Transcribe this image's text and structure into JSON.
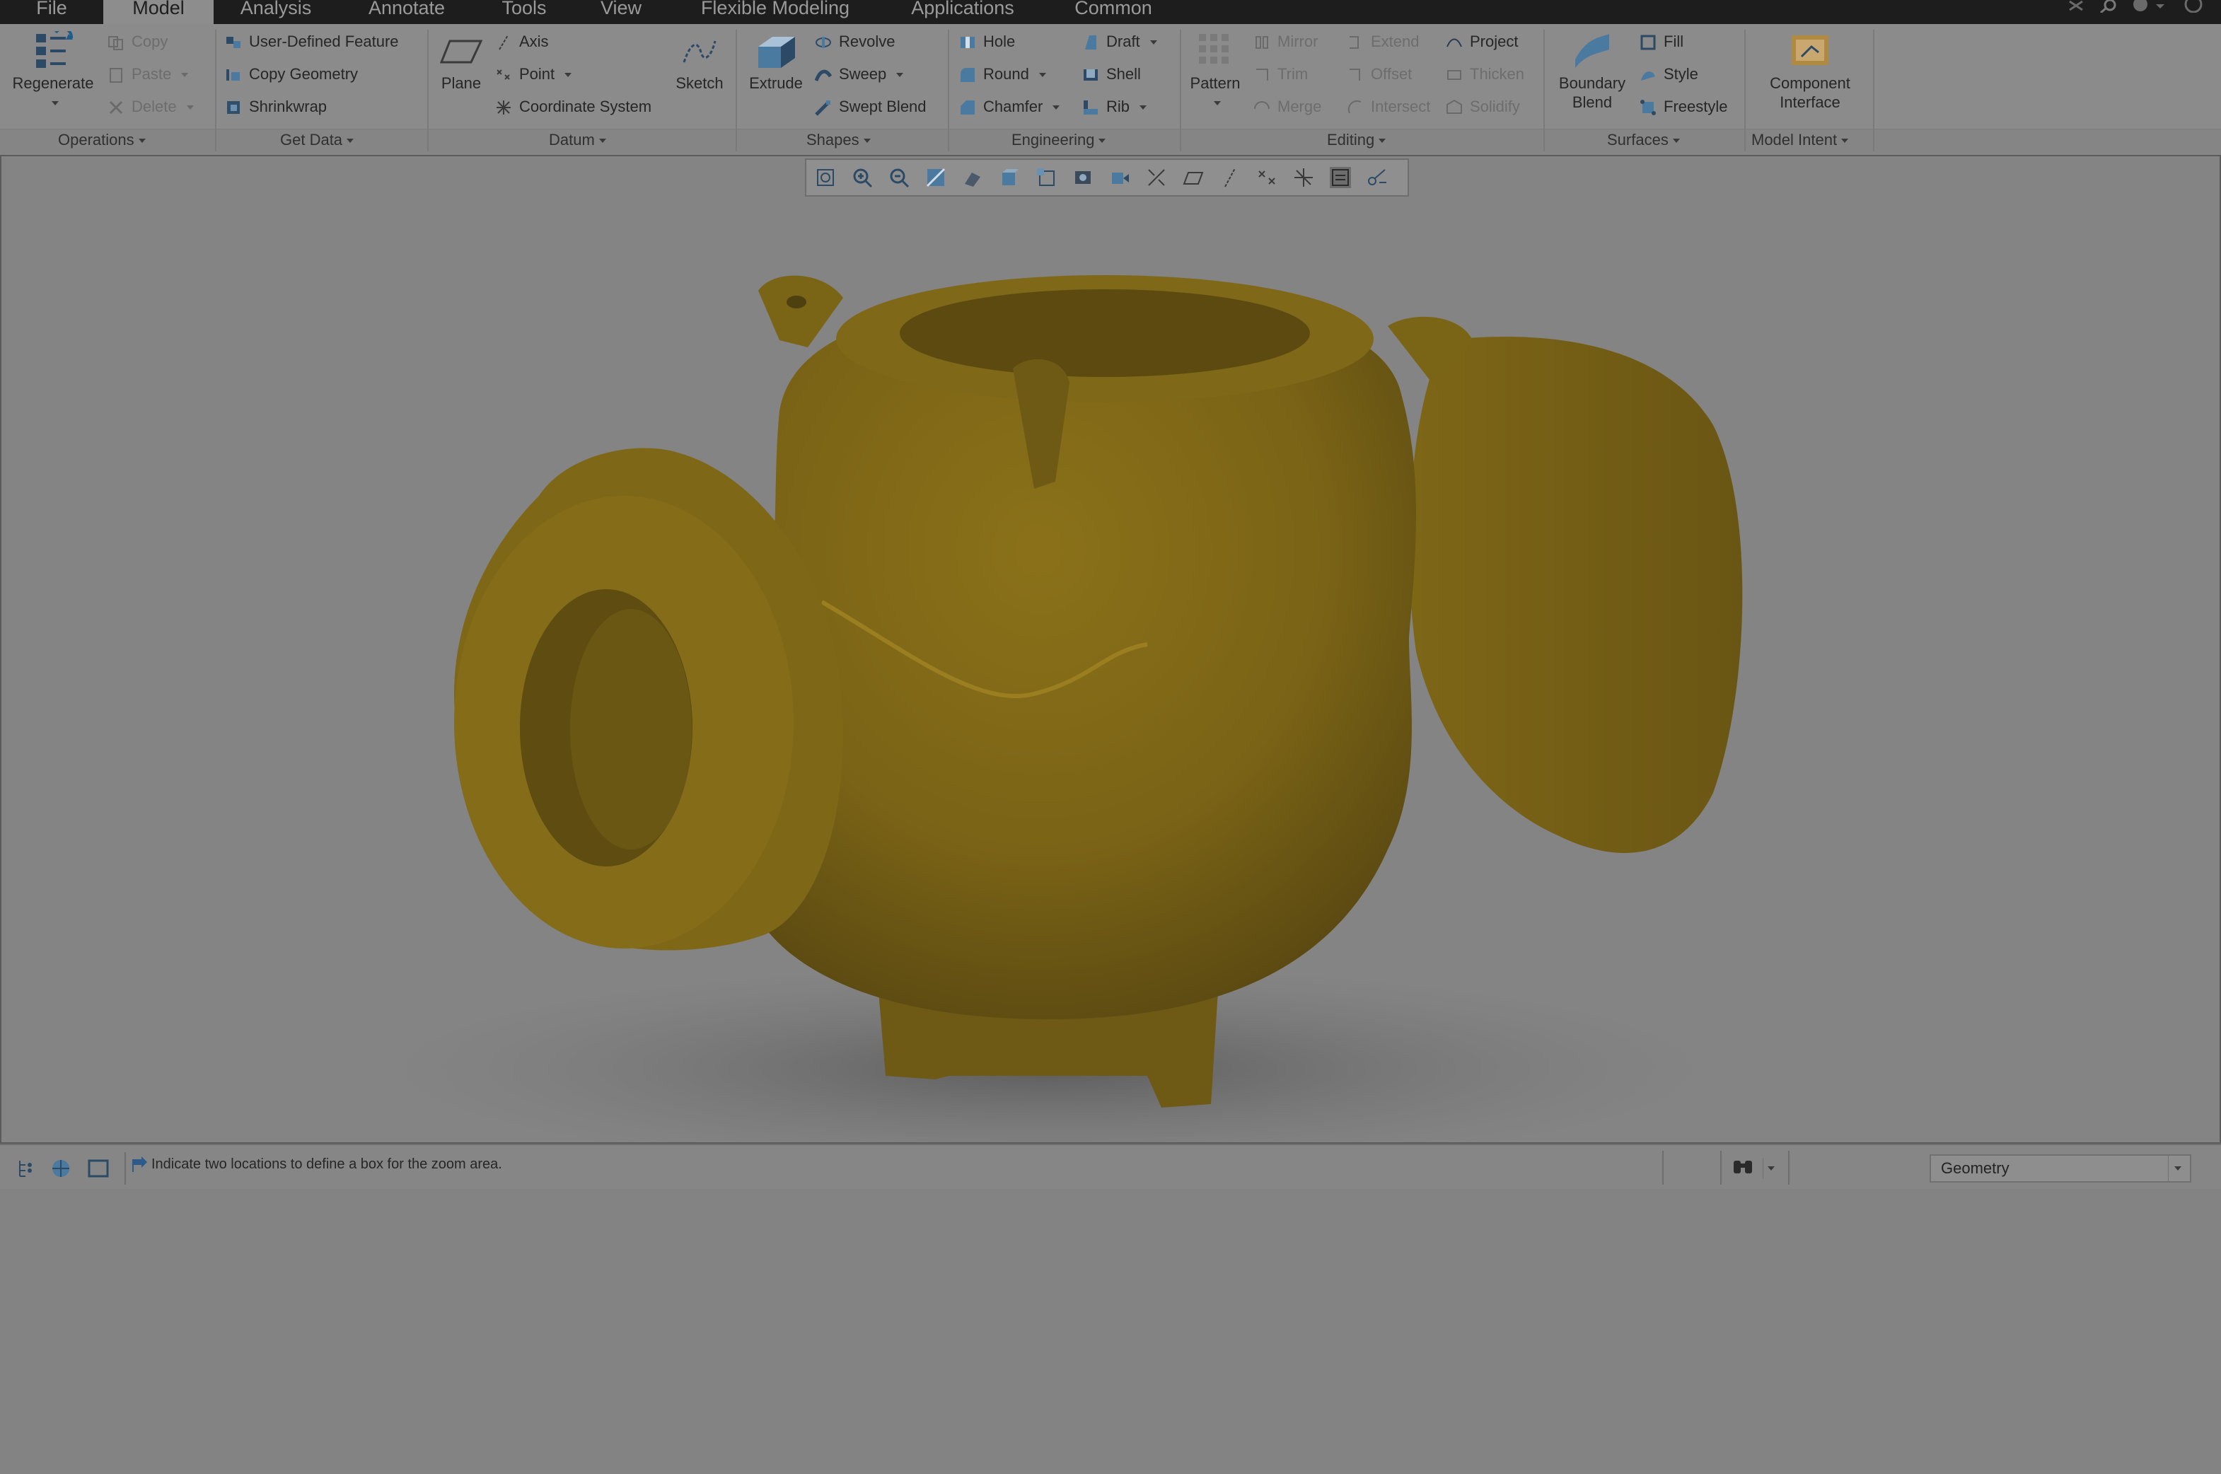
{
  "tabs": [
    {
      "label": "File"
    },
    {
      "label": "Model"
    },
    {
      "label": "Analysis"
    },
    {
      "label": "Annotate"
    },
    {
      "label": "Tools"
    },
    {
      "label": "View"
    },
    {
      "label": "Flexible Modeling"
    },
    {
      "label": "Applications"
    },
    {
      "label": "Common"
    }
  ],
  "ribbon": {
    "operations": {
      "regenerate": "Regenerate",
      "copy": "Copy",
      "paste": "Paste",
      "delete": "Delete",
      "group": "Operations"
    },
    "get_data": {
      "udf": "User-Defined Feature",
      "copy_geometry": "Copy Geometry",
      "shrinkwrap": "Shrinkwrap",
      "group": "Get Data"
    },
    "datum": {
      "plane": "Plane",
      "axis": "Axis",
      "point": "Point",
      "csys": "Coordinate System",
      "sketch": "Sketch",
      "group": "Datum"
    },
    "shapes": {
      "extrude": "Extrude",
      "revolve": "Revolve",
      "sweep": "Sweep",
      "swept_blend": "Swept Blend",
      "group": "Shapes"
    },
    "engineering": {
      "hole": "Hole",
      "round": "Round",
      "chamfer": "Chamfer",
      "draft": "Draft",
      "shell": "Shell",
      "rib": "Rib",
      "group": "Engineering"
    },
    "editing": {
      "pattern": "Pattern",
      "mirror": "Mirror",
      "trim": "Trim",
      "merge": "Merge",
      "extend": "Extend",
      "offset": "Offset",
      "intersect": "Intersect",
      "project": "Project",
      "thicken": "Thicken",
      "solidify": "Solidify",
      "group": "Editing"
    },
    "surfaces": {
      "boundary_blend_1": "Boundary",
      "boundary_blend_2": "Blend",
      "fill": "Fill",
      "style": "Style",
      "freestyle": "Freestyle",
      "group": "Surfaces"
    },
    "model_intent": {
      "component_interface_1": "Component",
      "component_interface_2": "Interface",
      "group": "Model Intent"
    }
  },
  "status": {
    "message": "Indicate two locations to define a box for the zoom area.",
    "filter": "Geometry"
  },
  "colors": {
    "part": "#7d6618",
    "part_dark": "#5f4c12",
    "part_light": "#a08322"
  }
}
